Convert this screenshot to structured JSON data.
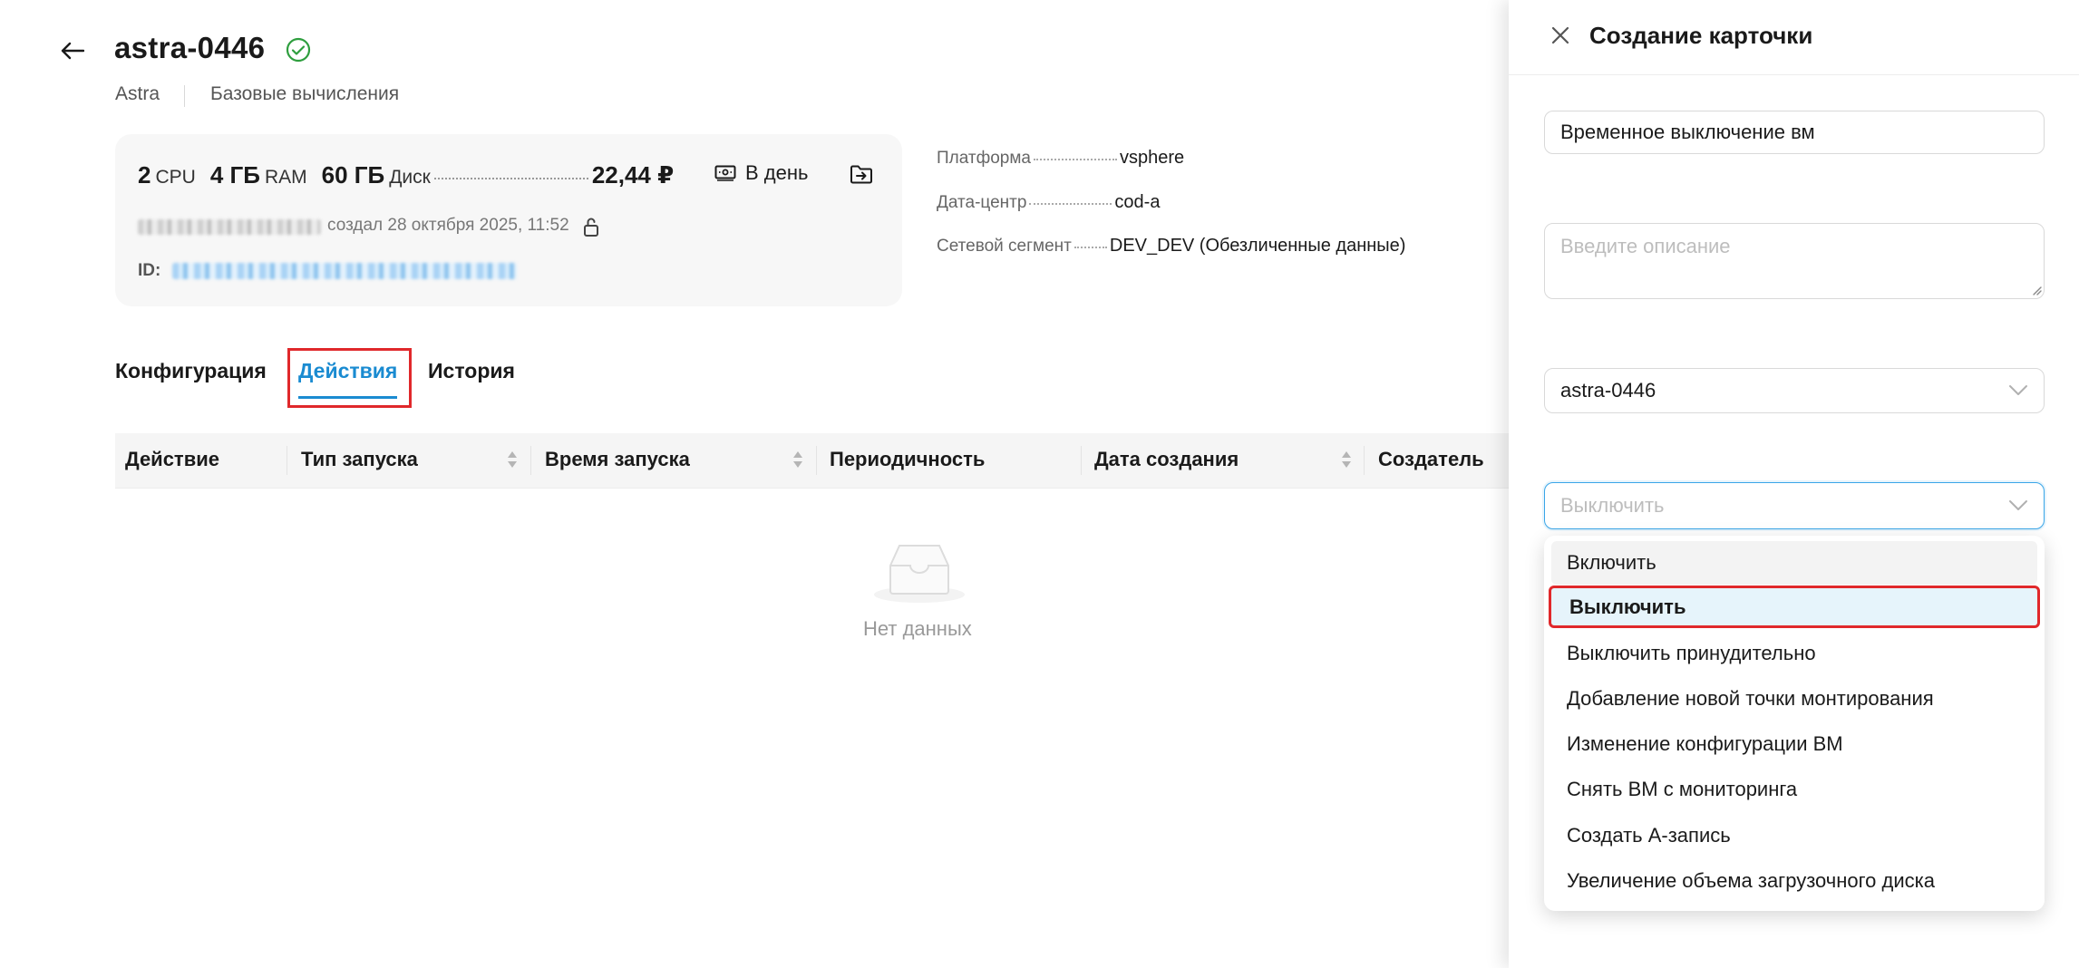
{
  "header": {
    "title": "astra-0446",
    "breadcrumb": [
      "Astra",
      "Базовые вычисления"
    ]
  },
  "summary": {
    "cpu_value": "2",
    "cpu_unit": "CPU",
    "ram_value": "4 ГБ",
    "ram_unit": "RAM",
    "disk_value": "60 ГБ",
    "disk_unit": "Диск",
    "price": "22,44 ₽",
    "period": "В день",
    "created": "создал 28 октября 2025, 11:52",
    "id_label": "ID:"
  },
  "properties": [
    {
      "label": "Платформа",
      "value": "vsphere"
    },
    {
      "label": "Дата-центр",
      "value": "cod-a"
    },
    {
      "label": "Сетевой сегмент",
      "value": "DEV_DEV (Обезличенные данные)"
    }
  ],
  "tabs": [
    "Конфигурация",
    "Действия",
    "История"
  ],
  "active_tab": "Действия",
  "table": {
    "columns": [
      "Действие",
      "Тип запуска",
      "Время запуска",
      "Периодичность",
      "Дата создания",
      "Создатель"
    ],
    "empty_text": "Нет данных"
  },
  "drawer": {
    "title": "Создание карточки",
    "name_value": "Временное выключение вм",
    "description_placeholder": "Введите описание",
    "vm_select_value": "astra-0446",
    "action_select_placeholder": "Выключить",
    "options": [
      "Включить",
      "Выключить",
      "Выключить принудительно",
      "Добавление новой точки монтирования",
      "Изменение конфигурации ВМ",
      "Снять ВМ с мониторинга",
      "Создать А-запись",
      "Увеличение объема загрузочного диска"
    ],
    "selected_option": "Выключить"
  },
  "colors": {
    "accent": "#1a8bd1",
    "highlight": "#e0282b",
    "status_ok": "#2e9e3e"
  }
}
